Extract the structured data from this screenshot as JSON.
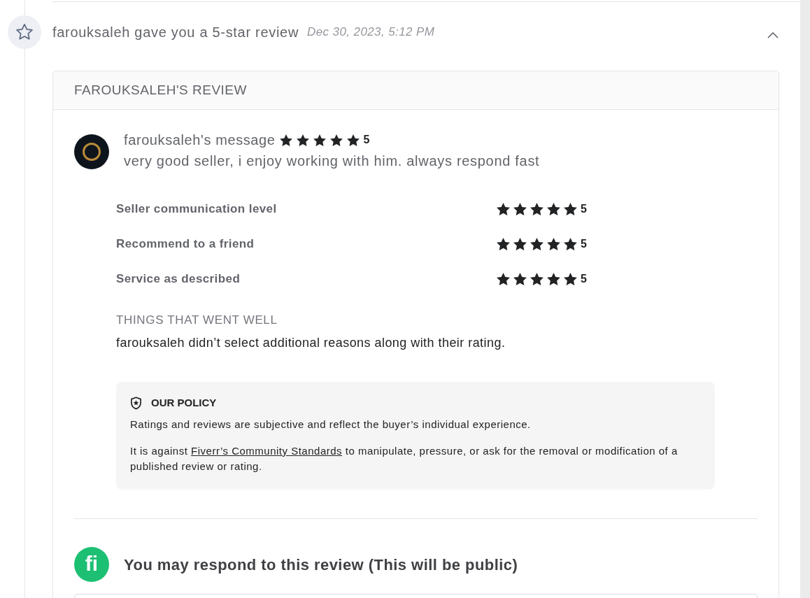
{
  "notification": {
    "title": "farouksaleh gave you a 5-star review",
    "date": "Dec 30, 2023, 5:12 PM",
    "expanded": true
  },
  "review": {
    "heading": "FAROUKSALEH'S REVIEW",
    "message_label": "farouksaleh's message",
    "stars": 5,
    "score": "5",
    "text": "very good seller, i enjoy working with him. always respond fast",
    "ratings": [
      {
        "label": "Seller communication level",
        "stars": 5,
        "score": "5"
      },
      {
        "label": "Recommend to a friend",
        "stars": 5,
        "score": "5"
      },
      {
        "label": "Service as described",
        "stars": 5,
        "score": "5"
      }
    ],
    "went_well": {
      "heading": "THINGS THAT WENT WELL",
      "text": "farouksaleh didn’t select additional reasons along with their rating."
    },
    "policy": {
      "heading": "OUR POLICY",
      "paragraphs": [
        {
          "parts": [
            {
              "kind": "text",
              "text": "Ratings and reviews are subjective and reflect the buyer’s individual experience."
            }
          ]
        },
        {
          "parts": [
            {
              "kind": "text",
              "text": "It is against "
            },
            {
              "kind": "link",
              "text": "Fiverr’s Community Standards"
            },
            {
              "kind": "text",
              "text": " to manipulate, pressure, or ask for the removal or modification of a published review or rating."
            }
          ]
        }
      ]
    }
  },
  "response": {
    "logo_text": "fi",
    "heading": "You may respond to this review (This will be public)"
  }
}
